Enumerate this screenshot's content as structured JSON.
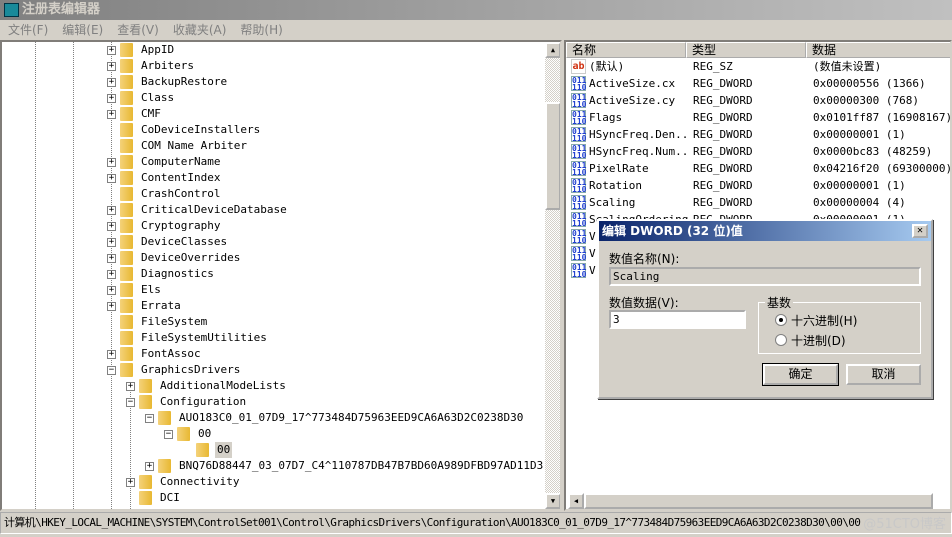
{
  "window": {
    "title": "注册表编辑器"
  },
  "menu": [
    "文件(F)",
    "编辑(E)",
    "查看(V)",
    "收藏夹(A)",
    "帮助(H)"
  ],
  "tree": [
    {
      "label": "AppID",
      "level": 0,
      "exp": "+"
    },
    {
      "label": "Arbiters",
      "level": 0,
      "exp": "+"
    },
    {
      "label": "BackupRestore",
      "level": 0,
      "exp": "+"
    },
    {
      "label": "Class",
      "level": 0,
      "exp": "+"
    },
    {
      "label": "CMF",
      "level": 0,
      "exp": "+"
    },
    {
      "label": "CoDeviceInstallers",
      "level": 0,
      "exp": ""
    },
    {
      "label": "COM Name Arbiter",
      "level": 0,
      "exp": ""
    },
    {
      "label": "ComputerName",
      "level": 0,
      "exp": "+"
    },
    {
      "label": "ContentIndex",
      "level": 0,
      "exp": "+"
    },
    {
      "label": "CrashControl",
      "level": 0,
      "exp": ""
    },
    {
      "label": "CriticalDeviceDatabase",
      "level": 0,
      "exp": "+"
    },
    {
      "label": "Cryptography",
      "level": 0,
      "exp": "+"
    },
    {
      "label": "DeviceClasses",
      "level": 0,
      "exp": "+"
    },
    {
      "label": "DeviceOverrides",
      "level": 0,
      "exp": "+"
    },
    {
      "label": "Diagnostics",
      "level": 0,
      "exp": "+"
    },
    {
      "label": "Els",
      "level": 0,
      "exp": "+"
    },
    {
      "label": "Errata",
      "level": 0,
      "exp": "+"
    },
    {
      "label": "FileSystem",
      "level": 0,
      "exp": ""
    },
    {
      "label": "FileSystemUtilities",
      "level": 0,
      "exp": ""
    },
    {
      "label": "FontAssoc",
      "level": 0,
      "exp": "+"
    },
    {
      "label": "GraphicsDrivers",
      "level": 0,
      "exp": "-"
    },
    {
      "label": "AdditionalModeLists",
      "level": 1,
      "exp": "+"
    },
    {
      "label": "Configuration",
      "level": 1,
      "exp": "-"
    },
    {
      "label": "AUO183C0_01_07D9_17^773484D75963EED9CA6A63D2C0238D30",
      "level": 2,
      "exp": "-"
    },
    {
      "label": "00",
      "level": 3,
      "exp": "-"
    },
    {
      "label": "00",
      "level": 4,
      "exp": "",
      "selected": true
    },
    {
      "label": "BNQ76D88447_03_07D7_C4^110787DB47B7BD60A989DFBD97AD11D3",
      "level": 2,
      "exp": "+"
    },
    {
      "label": "Connectivity",
      "level": 1,
      "exp": "+"
    },
    {
      "label": "DCI",
      "level": 1,
      "exp": ""
    }
  ],
  "list": {
    "headers": [
      "名称",
      "类型",
      "数据"
    ],
    "rows": [
      {
        "icon": "string-value-icon",
        "name": "(默认)",
        "type": "REG_SZ",
        "data": "(数值未设置)"
      },
      {
        "icon": "dword-value-icon",
        "name": "ActiveSize.cx",
        "type": "REG_DWORD",
        "data": "0x00000556 (1366)"
      },
      {
        "icon": "dword-value-icon",
        "name": "ActiveSize.cy",
        "type": "REG_DWORD",
        "data": "0x00000300 (768)"
      },
      {
        "icon": "dword-value-icon",
        "name": "Flags",
        "type": "REG_DWORD",
        "data": "0x0101ff87 (16908167)"
      },
      {
        "icon": "dword-value-icon",
        "name": "HSyncFreq.Den...",
        "type": "REG_DWORD",
        "data": "0x00000001 (1)"
      },
      {
        "icon": "dword-value-icon",
        "name": "HSyncFreq.Num...",
        "type": "REG_DWORD",
        "data": "0x0000bc83 (48259)"
      },
      {
        "icon": "dword-value-icon",
        "name": "PixelRate",
        "type": "REG_DWORD",
        "data": "0x04216f20 (69300000)"
      },
      {
        "icon": "dword-value-icon",
        "name": "Rotation",
        "type": "REG_DWORD",
        "data": "0x00000001 (1)"
      },
      {
        "icon": "dword-value-icon",
        "name": "Scaling",
        "type": "REG_DWORD",
        "data": "0x00000004 (4)"
      },
      {
        "icon": "dword-value-icon",
        "name": "ScalingOrdering",
        "type": "REG_DWORD",
        "data": "0x00000001 (1)"
      },
      {
        "icon": "dword-value-icon",
        "name": "V",
        "type": "",
        "data": ""
      },
      {
        "icon": "dword-value-icon",
        "name": "V",
        "type": "",
        "data": ""
      },
      {
        "icon": "dword-value-icon",
        "name": "V",
        "type": "",
        "data": ""
      }
    ]
  },
  "dialog": {
    "title": "编辑 DWORD (32 位)值",
    "name_label": "数值名称(N):",
    "name_value": "Scaling",
    "data_label": "数值数据(V):",
    "data_value": "3",
    "base_label": "基数",
    "hex_label": "十六进制(H)",
    "dec_label": "十进制(D)",
    "selected_base": "hex",
    "ok": "确定",
    "cancel": "取消"
  },
  "status": "计算机\\HKEY_LOCAL_MACHINE\\SYSTEM\\ControlSet001\\Control\\GraphicsDrivers\\Configuration\\AUO183C0_01_07D9_17^773484D75963EED9CA6A63D2C0238D30\\00\\00",
  "watermark": "@51CTO博客"
}
